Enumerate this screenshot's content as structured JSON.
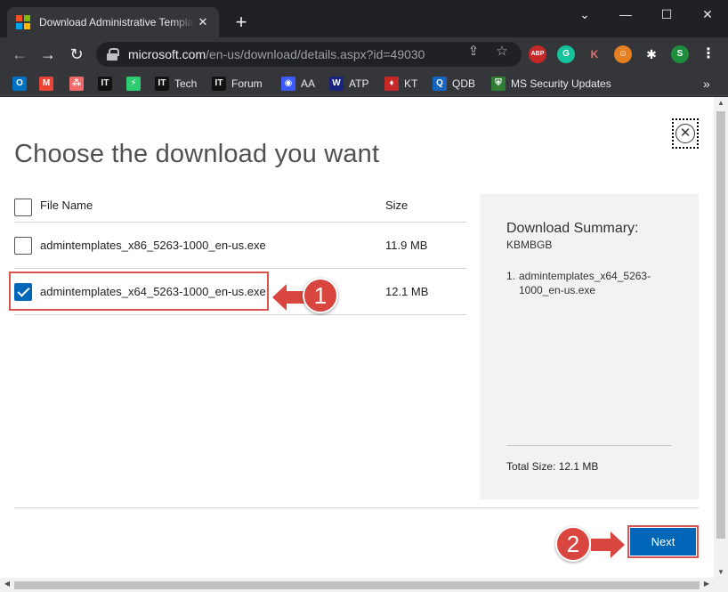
{
  "browser": {
    "tab_title": "Download Administrative Templates",
    "tab_close": "✕",
    "new_tab": "+",
    "controls": {
      "minimize": "⌄",
      "min": "—",
      "max": "☐",
      "close": "✕"
    },
    "nav": {
      "back": "←",
      "forward": "→",
      "reload": "↻"
    },
    "url_host": "microsoft.com",
    "url_path": "/en-us/download/details.aspx?id=49030",
    "omnibox_icons": {
      "share": "⇪",
      "star": "☆"
    },
    "extensions": [
      {
        "label": "ABP",
        "color": "#c62828"
      },
      {
        "label": "G",
        "color": "#15c39a"
      },
      {
        "label": "K",
        "color": "#35363a"
      },
      {
        "label": "☺",
        "color": "#e67e22"
      },
      {
        "label": "✱",
        "color": "#35363a"
      },
      {
        "label": "S",
        "color": "#1e8e3e"
      },
      {
        "label": "⋮",
        "color": "#35363a"
      }
    ],
    "bookmarks": [
      {
        "label": "",
        "icon": "O",
        "color": "#0072c6"
      },
      {
        "label": "",
        "icon": "M",
        "color": "#ea4335"
      },
      {
        "label": "",
        "icon": "⁂",
        "color": "#f06a6a"
      },
      {
        "label": "",
        "icon": "IT",
        "color": "#111111"
      },
      {
        "label": "",
        "icon": "⚡",
        "color": "#2ecc71"
      },
      {
        "label": "Tech",
        "icon": "IT",
        "color": "#111111"
      },
      {
        "label": "Forum",
        "icon": "IT",
        "color": "#111111"
      },
      {
        "label": "AA",
        "icon": "◉",
        "color": "#3d5afe"
      },
      {
        "label": "ATP",
        "icon": "W",
        "color": "#1a237e"
      },
      {
        "label": "KT",
        "icon": "♦",
        "color": "#c62828"
      },
      {
        "label": "QDB",
        "icon": "Q",
        "color": "#1565c0"
      },
      {
        "label": "MS Security Updates",
        "icon": "⛨",
        "color": "#2e7d32"
      }
    ],
    "bookmarks_more": "»"
  },
  "dialog": {
    "title": "Choose the download you want",
    "close_icon": "✕",
    "table": {
      "col_name": "File Name",
      "col_size": "Size",
      "rows": [
        {
          "name": "admintemplates_x86_5263-1000_en-us.exe",
          "size": "11.9 MB",
          "checked": false
        },
        {
          "name": "admintemplates_x64_5263-1000_en-us.exe",
          "size": "12.1 MB",
          "checked": true
        }
      ]
    },
    "summary": {
      "title": "Download Summary:",
      "code": "KBMBGB",
      "item_number": "1.",
      "item_name": "admintemplates_x64_5263-1000_en-us.exe",
      "total": "Total Size: 12.1 MB"
    },
    "next_label": "Next"
  },
  "annotations": {
    "step1": "1",
    "step2": "2"
  },
  "accent_color": "#0067b8",
  "annotation_color": "#d9463f"
}
